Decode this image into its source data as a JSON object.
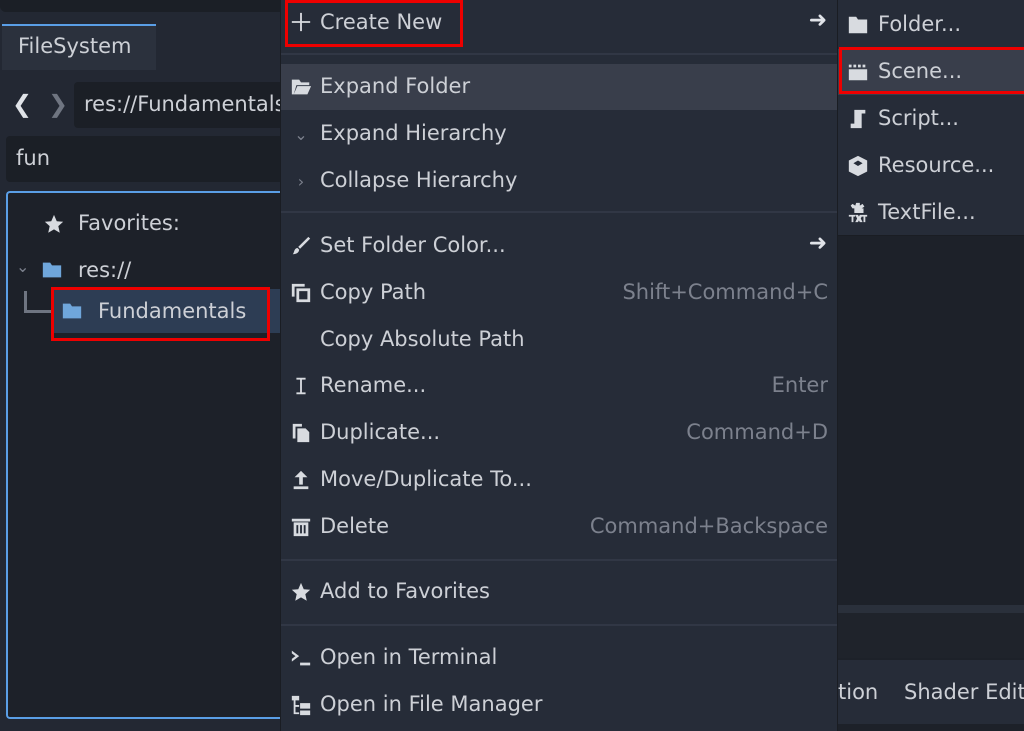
{
  "filesystem": {
    "tab_label": "FileSystem",
    "back_icon": "chevron-left-icon",
    "forward_icon": "chevron-right-icon",
    "path_value": "res://Fundamentals",
    "search_value": "fun",
    "tree": {
      "favorites_label": "Favorites:",
      "root_label": "res://",
      "selected_folder": "Fundamentals"
    },
    "accent_color": "#5a9ee6"
  },
  "context_menu": {
    "items": [
      {
        "label": "Create New",
        "icon": "plus-icon",
        "submenu": true
      },
      {
        "label": "Expand Folder",
        "icon": "folder-open-icon",
        "highlighted": true
      },
      {
        "label": "Expand Hierarchy",
        "icon": "chevron-down-icon"
      },
      {
        "label": "Collapse Hierarchy",
        "icon": "chevron-right-icon"
      },
      {
        "label": "Set Folder Color...",
        "icon": "brush-icon",
        "submenu": true
      },
      {
        "label": "Copy Path",
        "icon": "copy-icon",
        "shortcut": "Shift+Command+C"
      },
      {
        "label": "Copy Absolute Path"
      },
      {
        "label": "Rename...",
        "icon": "text-cursor-icon",
        "shortcut": "Enter"
      },
      {
        "label": "Duplicate...",
        "icon": "duplicate-icon",
        "shortcut": "Command+D"
      },
      {
        "label": "Move/Duplicate To...",
        "icon": "move-up-icon"
      },
      {
        "label": "Delete",
        "icon": "trash-icon",
        "shortcut": "Command+Backspace"
      },
      {
        "label": "Add to Favorites",
        "icon": "star-icon"
      },
      {
        "label": "Open in Terminal",
        "icon": "terminal-icon"
      },
      {
        "label": "Open in File Manager",
        "icon": "file-manager-icon"
      }
    ]
  },
  "submenu": {
    "items": [
      {
        "label": "Folder...",
        "icon": "folder-icon"
      },
      {
        "label": "Scene...",
        "icon": "clapperboard-icon",
        "highlighted": true
      },
      {
        "label": "Script...",
        "icon": "script-icon"
      },
      {
        "label": "Resource...",
        "icon": "cube-icon"
      },
      {
        "label": "TextFile...",
        "icon": "text-file-icon"
      }
    ]
  },
  "bottom_panel": {
    "tabs": [
      "tion",
      "Shader Edit"
    ]
  },
  "highlight_color": "#ee0000"
}
